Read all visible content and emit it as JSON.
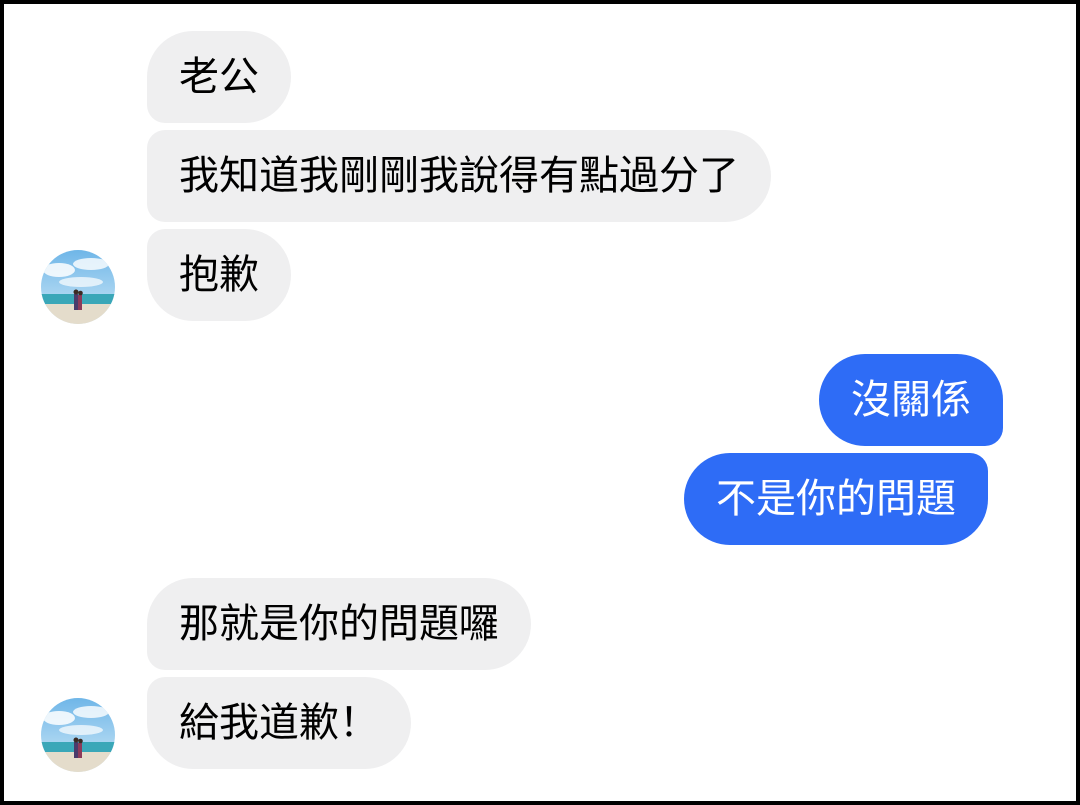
{
  "colors": {
    "incoming_bubble": "#efeff0",
    "outgoing_bubble": "#2e6cf6",
    "incoming_text": "#000000",
    "outgoing_text": "#ffffff"
  },
  "avatar": {
    "icon": "beach-couple-avatar-icon"
  },
  "messages": [
    {
      "from": "them",
      "text": "老公"
    },
    {
      "from": "them",
      "text": "我知道我剛剛我說得有點過分了"
    },
    {
      "from": "them",
      "text": "抱歉"
    },
    {
      "from": "me",
      "text": "沒關係"
    },
    {
      "from": "me",
      "text": "不是你的問題"
    },
    {
      "from": "them",
      "text": "那就是你的問題囉"
    },
    {
      "from": "them",
      "text": "給我道歉！"
    }
  ]
}
